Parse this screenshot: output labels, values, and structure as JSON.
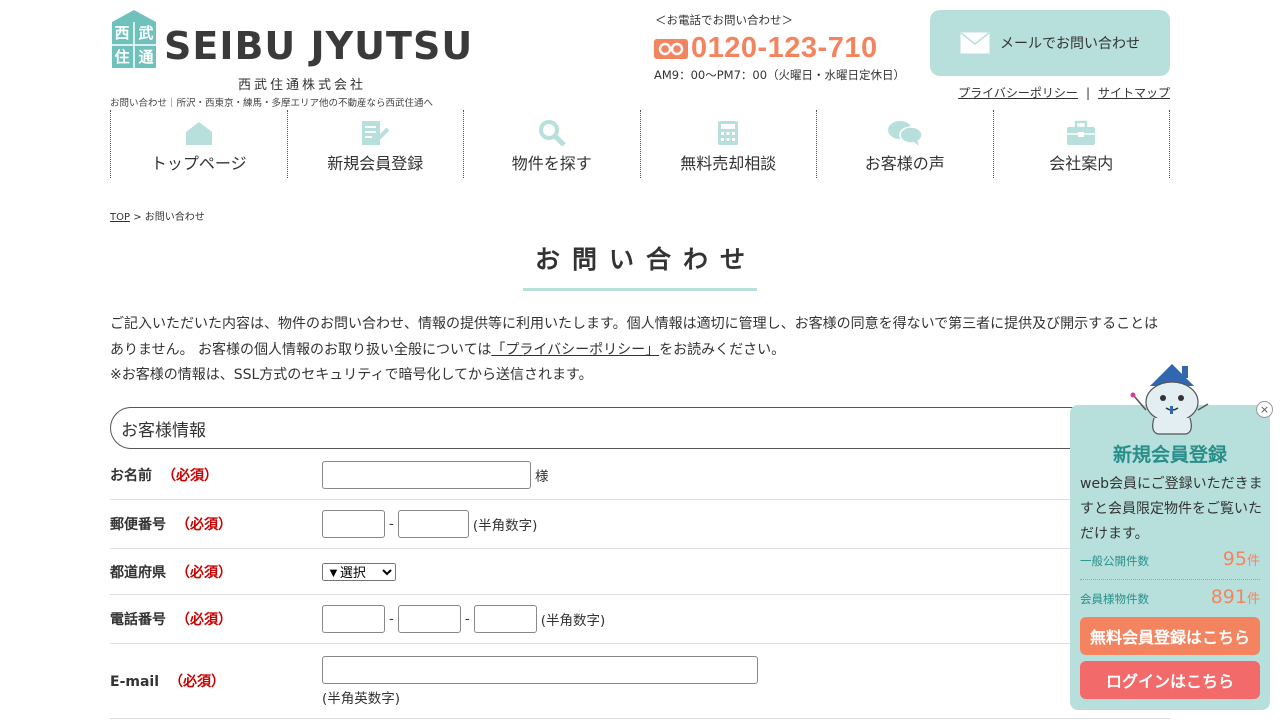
{
  "header": {
    "logo_kanji": [
      "西",
      "武",
      "住",
      "通"
    ],
    "logo_title": "SEIBU JYUTSU",
    "logo_sub": "西武住通株式会社",
    "tagline": "お問い合わせ｜所沢・西東京・練馬・多摩エリア他の不動産なら西武住通へ",
    "phone_caption": "＜お電話でお問い合わせ＞",
    "phone_number": "0120-123-710",
    "phone_hours": "AM9：00〜PM7：00（火曜日・水曜日定休日）",
    "mail_button": "メールでお問い合わせ",
    "links": [
      "プライバシーポリシー",
      "サイトマップ"
    ]
  },
  "nav": [
    {
      "label": "トップページ",
      "icon": "house-icon"
    },
    {
      "label": "新規会員登録",
      "icon": "document-pen-icon"
    },
    {
      "label": "物件を探す",
      "icon": "magnifier-icon"
    },
    {
      "label": "無料売却相談",
      "icon": "calculator-icon"
    },
    {
      "label": "お客様の声",
      "icon": "speech-bubbles-icon"
    },
    {
      "label": "会社案内",
      "icon": "briefcase-icon"
    }
  ],
  "breadcrumb": {
    "top": "TOP",
    "sep": ">",
    "current": "お問い合わせ"
  },
  "page_title": "お問い合わせ",
  "intro": {
    "line1": "ご記入いただいた内容は、物件のお問い合わせ、情報の提供等に利用いたします。個人情報は適切に管理し、お客様の同意を得ないで第三者に提供及び開示することは",
    "line2_pre": "ありません。 お客様の個人情報のお取り扱い全般については",
    "line2_link": "「プライバシーポリシー」",
    "line2_post": "をお読みください。",
    "line3": "※お客様の情報は、SSL方式のセキュリティで暗号化してから送信されます。"
  },
  "section_title": "お客様情報",
  "required_label": "（必須）",
  "form": {
    "name_label": "お名前",
    "name_suffix": "様",
    "zip_label": "郵便番号",
    "zip_note": "(半角数字)",
    "pref_label": "都道府県",
    "pref_selected": "▼選択",
    "tel_label": "電話番号",
    "tel_note": "(半角数字)",
    "email_label": "E-mail",
    "email_note": "(半角英数字)",
    "dash": "-"
  },
  "panel": {
    "close": "×",
    "title": "新規会員登録",
    "desc": "web会員にご登録いただきますと会員限定物件をご覧いただけます。",
    "public_label": "一般公開件数",
    "public_count": "95",
    "member_label": "会員様物件数",
    "member_count": "891",
    "unit": "件",
    "register_button": "無料会員登録はこちら",
    "login_button": "ログインはこちら"
  },
  "colors": {
    "accent": "#b7e0dc",
    "brand_teal": "#6fc2bb",
    "orange": "#f4845f",
    "red": "#f26a6a",
    "required": "#cc0000"
  }
}
